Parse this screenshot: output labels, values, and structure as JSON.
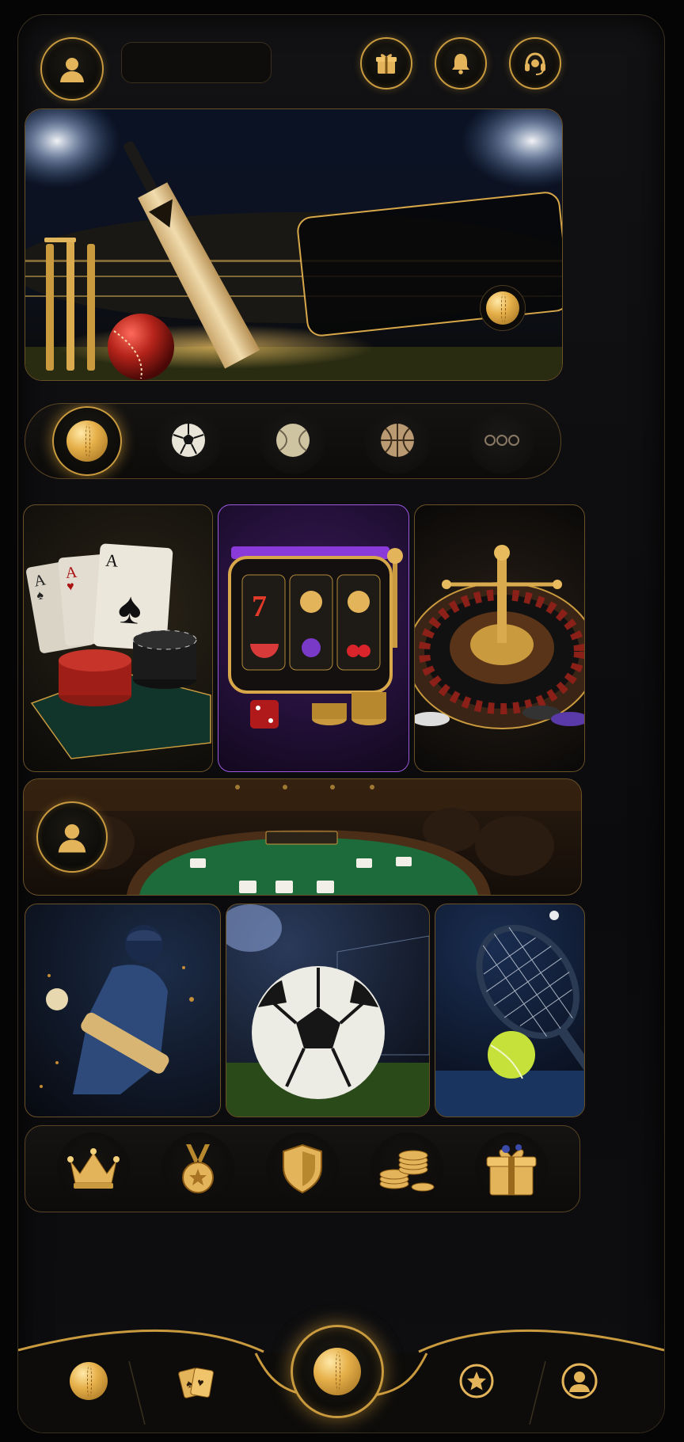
{
  "header": {
    "profile_icon": "user-icon",
    "search_placeholder": "",
    "actions": [
      {
        "name": "gift-icon"
      },
      {
        "name": "bell-icon"
      },
      {
        "name": "headset-icon"
      }
    ]
  },
  "banner": {
    "scene": "cricket-stadium",
    "overlay_card_icon": "cricket-ball-icon"
  },
  "sport_selector": {
    "items": [
      {
        "name": "cricket-ball-icon",
        "active": true
      },
      {
        "name": "soccer-ball-icon",
        "active": false
      },
      {
        "name": "tennis-ball-icon",
        "active": false
      },
      {
        "name": "basketball-icon",
        "active": false
      },
      {
        "name": "more-dots-icon",
        "active": false
      }
    ]
  },
  "casino_cards": [
    {
      "name": "poker-card"
    },
    {
      "name": "slots-card"
    },
    {
      "name": "roulette-card"
    }
  ],
  "live_table": {
    "avatar_icon": "user-icon"
  },
  "sport_cards": [
    {
      "name": "cricket-card"
    },
    {
      "name": "football-card"
    },
    {
      "name": "tennis-card"
    }
  ],
  "rewards_row": {
    "items": [
      {
        "name": "crown-icon"
      },
      {
        "name": "medal-icon"
      },
      {
        "name": "shield-icon"
      },
      {
        "name": "coins-icon"
      },
      {
        "name": "gift-box-icon"
      }
    ]
  },
  "bottom_nav": {
    "items": [
      {
        "name": "cricket-ball-icon"
      },
      {
        "name": "cards-icon"
      },
      {
        "name": "home-ball-icon"
      },
      {
        "name": "star-badge-icon"
      },
      {
        "name": "user-icon"
      }
    ]
  },
  "colors": {
    "gold": "#c99a3e",
    "background": "#0b0b0d",
    "purple_accent": "#7a2fc0",
    "felt_green": "#1f6b3a"
  }
}
